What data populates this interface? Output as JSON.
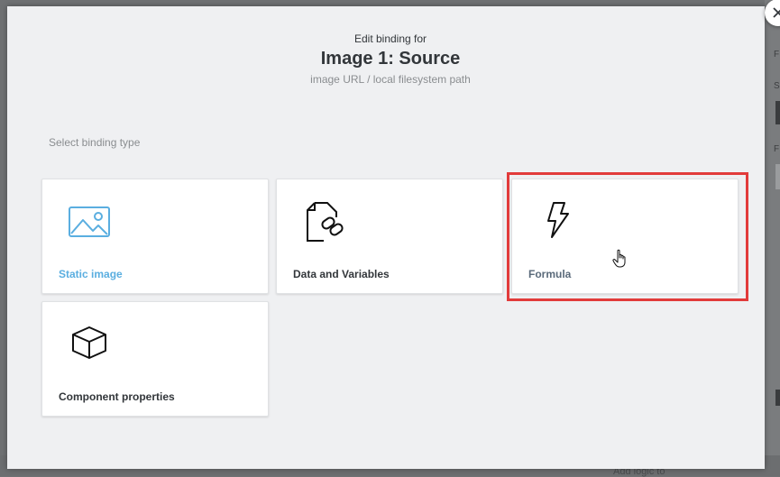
{
  "dialog": {
    "pretitle": "Edit binding for",
    "title": "Image 1: Source",
    "subtitle": "image URL / local filesystem path",
    "close_icon": "close-icon"
  },
  "section_label": "Select binding type",
  "binding_types": [
    {
      "label": "Static image",
      "icon": "image-icon"
    },
    {
      "label": "Data and Variables",
      "icon": "data-link-icon"
    },
    {
      "label": "Formula",
      "icon": "lightning-icon",
      "selected": true
    },
    {
      "label": "Component properties",
      "icon": "cube-icon"
    }
  ],
  "background": {
    "footer_text": "Add logic to"
  },
  "colors": {
    "highlight": "#e23b3b",
    "static_image_accent": "#5aaee0",
    "dialog_bg": "#eff0f2"
  }
}
